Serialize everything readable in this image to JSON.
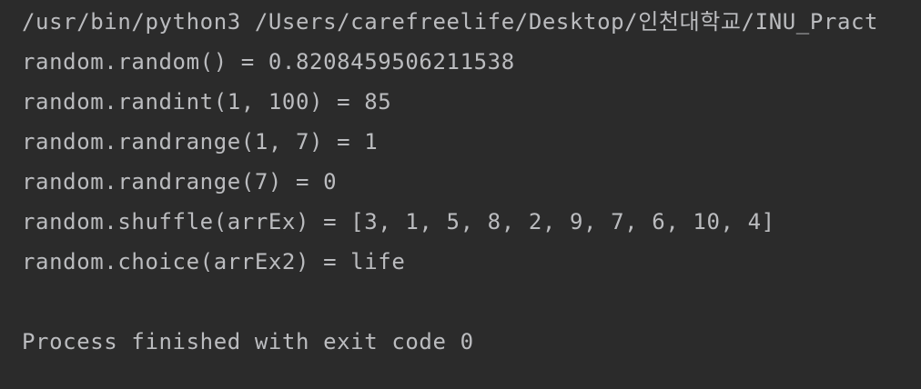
{
  "console": {
    "command": "/usr/bin/python3 /Users/carefreelife/Desktop/인천대학교/INU_Pract",
    "output": [
      "random.random() = 0.8208459506211538",
      "random.randint(1, 100) = 85",
      "random.randrange(1, 7) = 1",
      "random.randrange(7) = 0",
      "random.shuffle(arrEx) = [3, 1, 5, 8, 2, 9, 7, 6, 10, 4]",
      "random.choice(arrEx2) = life"
    ],
    "status": "Process finished with exit code 0"
  },
  "colors": {
    "background": "#2b2b2b",
    "text": "#bbbcbf"
  }
}
